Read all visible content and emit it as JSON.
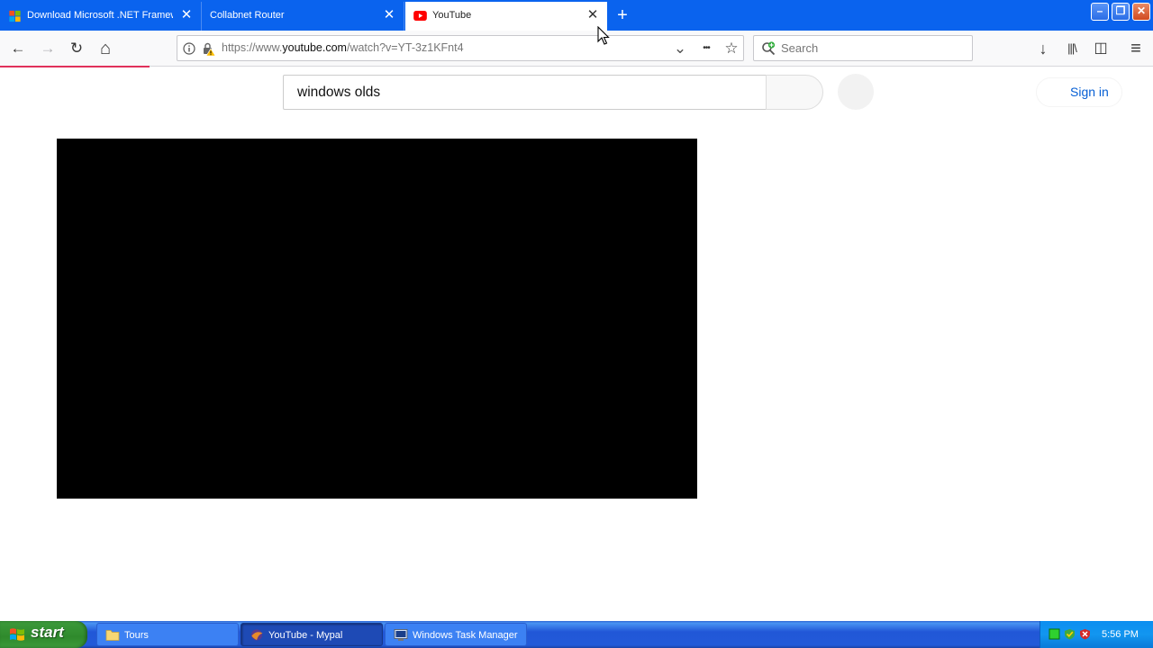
{
  "browser": {
    "tabs": [
      {
        "title": "Download Microsoft .NET Framew",
        "icon": "windows-logo-icon",
        "active": false
      },
      {
        "title": "Collabnet Router",
        "icon": "",
        "active": false
      },
      {
        "title": "YouTube",
        "icon": "youtube-icon",
        "active": true
      }
    ],
    "close_glyph": "✕",
    "new_tab_glyph": "+",
    "window_controls": {
      "minimize": "–",
      "restore": "❐",
      "close": "✕"
    },
    "nav": {
      "back_glyph": "←",
      "forward_glyph": "→",
      "reload_glyph": "↻",
      "home_glyph": "⌂"
    },
    "url": {
      "prefix": "https://www.",
      "host": "youtube.com",
      "path": "/watch?v=YT-3z1KFnt4"
    },
    "search_placeholder": "Search",
    "toolbar": {
      "downloads_glyph": "↓",
      "library_glyph": "|||\\",
      "sidebar_glyph": "◫",
      "menu_glyph": "≡",
      "page_actions_glyph": "•••",
      "bookmark_glyph": "☆",
      "dropdown_glyph": "⌄"
    },
    "load_progress": 0.13
  },
  "page": {
    "search_value": "windows olds",
    "sign_in_label": "Sign in"
  },
  "taskbar": {
    "start_label": "start",
    "items": [
      {
        "label": "Tours",
        "icon": "folder-icon",
        "state": "normal"
      },
      {
        "label": "YouTube - Mypal",
        "icon": "mypal-icon",
        "state": "pressed"
      },
      {
        "label": "Windows Task Manager",
        "icon": "task-manager-icon",
        "state": "normal"
      }
    ],
    "tray_icons": [
      "network-icon",
      "security-shield-icon",
      "antivirus-icon"
    ],
    "clock": "5:56 PM"
  },
  "colors": {
    "tabbar_bg": "#0a63ee",
    "yt_link": "#065fd4",
    "load_bar": "#e0315a"
  }
}
